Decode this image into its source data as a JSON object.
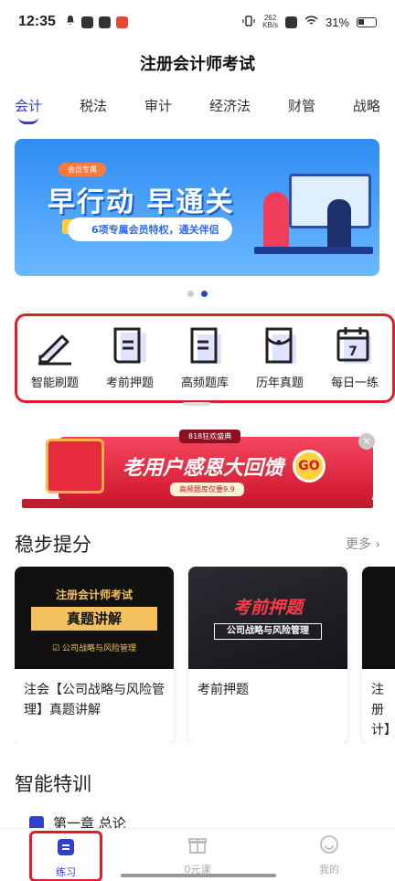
{
  "status_bar": {
    "time": "12:35",
    "net_speed_value": "262",
    "net_speed_unit": "KB/s",
    "battery": "31%"
  },
  "page_title": "注册会计师考试",
  "tabs": [
    {
      "label": "会计",
      "active": true
    },
    {
      "label": "税法"
    },
    {
      "label": "审计"
    },
    {
      "label": "经济法"
    },
    {
      "label": "财管"
    },
    {
      "label": "战略"
    }
  ],
  "banner": {
    "tag": "会员专属",
    "headline": "早行动 早通关",
    "subline": "6项专属会员特权，通关伴侣",
    "page_count": 2,
    "active_page": 2
  },
  "quick_nav": [
    {
      "label": "智能刷题",
      "icon": "pencil-icon"
    },
    {
      "label": "考前押题",
      "icon": "scroll-icon"
    },
    {
      "label": "高频题库",
      "icon": "document-icon"
    },
    {
      "label": "历年真题",
      "icon": "folder-icon"
    },
    {
      "label": "每日一练",
      "icon": "calendar-icon",
      "day": "7"
    }
  ],
  "promo": {
    "top_tag": "818狂欢盛典",
    "headline": "老用户感恩大回馈",
    "go": "GO",
    "sub_tag": "高频题库仅要9.9",
    "close": "×"
  },
  "section_steady": {
    "title": "稳步提分",
    "more": "更多 ›"
  },
  "course_cards": [
    {
      "thumb_line1": "注册会计师考试",
      "thumb_line2": "真题讲解",
      "thumb_line3": "☑ 公司战略与风险管理",
      "name": "注会【公司战略与风险管理】真题讲解"
    },
    {
      "thumb_line1": "考前押题",
      "thumb_line2": "公司战略与风险管理",
      "name": "考前押题"
    },
    {
      "name": "注册计】"
    }
  ],
  "section_training": {
    "title": "智能特训",
    "chapter": "第一章 总论"
  },
  "bottom_nav": [
    {
      "label": "练习",
      "icon": "practice-icon",
      "active": true
    },
    {
      "label": "0元课",
      "icon": "gift-icon"
    },
    {
      "label": "我的",
      "icon": "smile-icon"
    }
  ],
  "colors": {
    "accent": "#2f3fcf",
    "highlight_box": "#e11d2a"
  }
}
